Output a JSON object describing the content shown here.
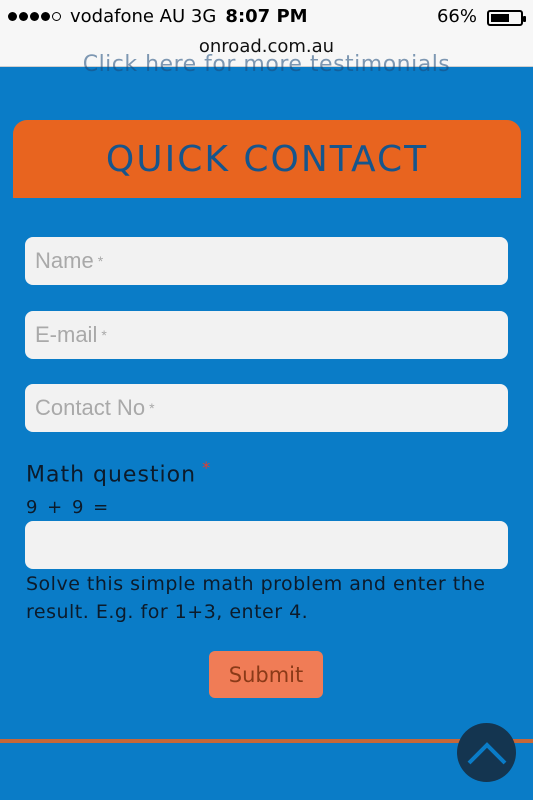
{
  "status_bar": {
    "carrier": "vodafone AU  3G",
    "time": "8:07 PM",
    "battery_percent": "66%",
    "battery_level": 0.66,
    "url": "onroad.com.au"
  },
  "page": {
    "partial_link_text": "Click here for more testimonials"
  },
  "contact_form": {
    "title": "QUICK CONTACT",
    "name_placeholder": "Name",
    "email_placeholder": "E-mail",
    "contact_placeholder": "Contact No",
    "required_mark": "*",
    "math_label": "Math question",
    "math_question": "9 + 9 =",
    "math_hint": "Solve this simple math problem and enter the result. E.g. for 1+3, enter 4.",
    "submit_label": "Submit"
  },
  "colors": {
    "background": "#0a7cc7",
    "header": "#e8641f",
    "submit": "#f07c56"
  }
}
